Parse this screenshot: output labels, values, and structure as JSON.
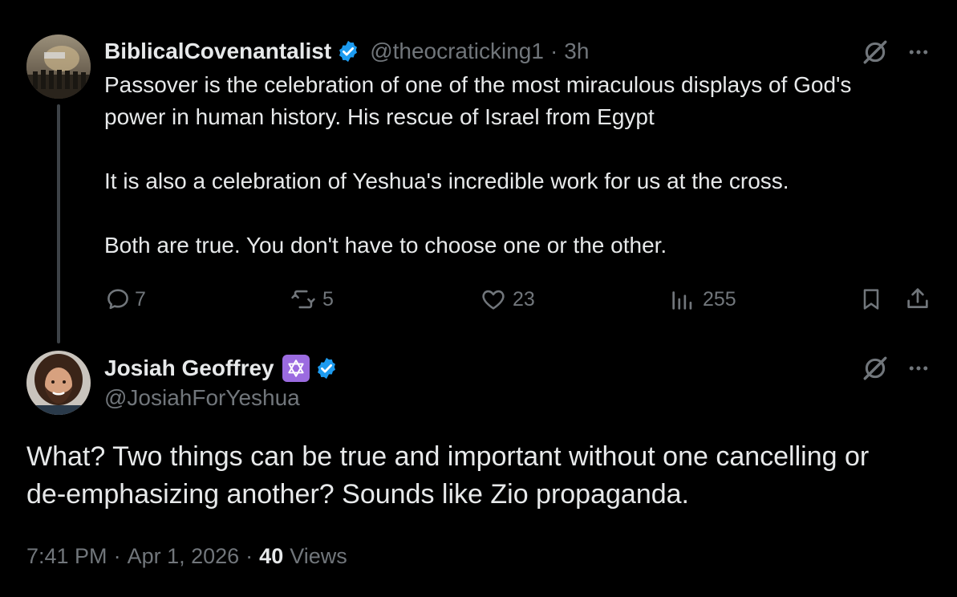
{
  "post": {
    "display_name": "BiblicalCovenantalist",
    "handle": "@theocraticking1",
    "separator": "·",
    "time": "3h",
    "verified_icon": "verified-badge-icon",
    "text_line1": "Passover is the celebration of one of the most miraculous displays of God's",
    "text_line2": "power in human history. His rescue of Israel from Egypt",
    "text_line3": "It is also a celebration of Yeshua's incredible work for us at the cross.",
    "text_line4": "Both are true. You don't have to choose one or the other.",
    "replies": "7",
    "reposts": "5",
    "likes": "23",
    "views": "255"
  },
  "reply": {
    "display_name": "Josiah Geoffrey",
    "emoji_icon": "star-of-david-icon",
    "handle": "@JosiahForYeshua",
    "text_line1": "What? Two things can be true and important without one cancelling or",
    "text_line2": "de-emphasizing another? Sounds like Zio propaganda.",
    "time": "7:41 PM",
    "sep1": "·",
    "date": "Apr 1, 2026",
    "sep2": "·",
    "views_count": "40",
    "views_label": "Views"
  },
  "colors": {
    "background": "#000000",
    "text": "#e7e9ea",
    "muted": "#71767b",
    "verified": "#1d9bf0",
    "emoji_bg": "#9b6be0"
  }
}
